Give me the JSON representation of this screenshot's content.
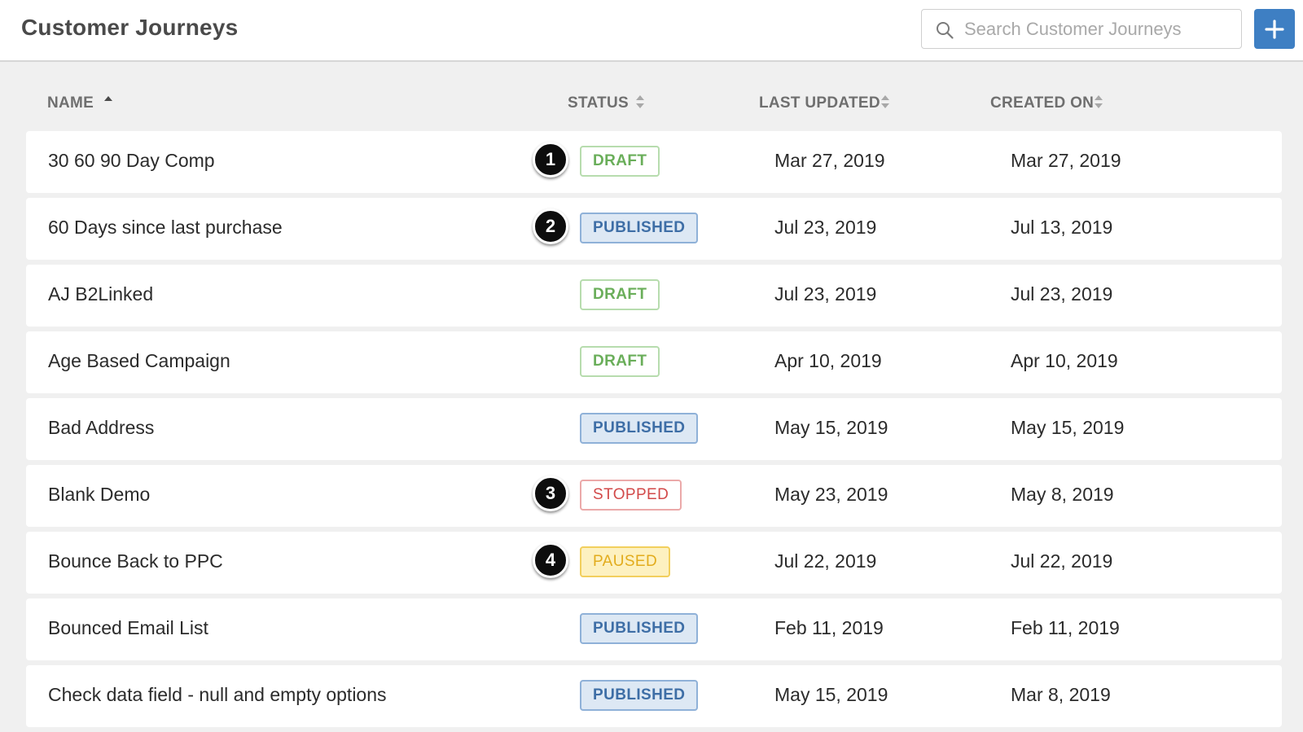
{
  "header": {
    "title": "Customer Journeys",
    "search_placeholder": "Search Customer Journeys",
    "add_icon": "plus-icon",
    "search_icon": "search-icon"
  },
  "columns": {
    "name": "NAME",
    "status": "STATUS",
    "last_updated": "LAST UPDATED",
    "created_on": "CREATED ON",
    "sorted_by": "NAME",
    "sort_direction": "ascending"
  },
  "rows": [
    {
      "name": "30 60 90 Day Comp",
      "status": "DRAFT",
      "status_kind": "draft",
      "last_updated": "Mar 27, 2019",
      "created_on": "Mar 27, 2019",
      "marker": "1"
    },
    {
      "name": "60 Days since last purchase",
      "status": "PUBLISHED",
      "status_kind": "published",
      "last_updated": "Jul 23, 2019",
      "created_on": "Jul 13, 2019",
      "marker": "2"
    },
    {
      "name": "AJ B2Linked",
      "status": "DRAFT",
      "status_kind": "draft",
      "last_updated": "Jul 23, 2019",
      "created_on": "Jul 23, 2019",
      "marker": ""
    },
    {
      "name": "Age Based Campaign",
      "status": "DRAFT",
      "status_kind": "draft",
      "last_updated": "Apr 10, 2019",
      "created_on": "Apr 10, 2019",
      "marker": ""
    },
    {
      "name": "Bad Address",
      "status": "PUBLISHED",
      "status_kind": "published",
      "last_updated": "May 15, 2019",
      "created_on": "May 15, 2019",
      "marker": ""
    },
    {
      "name": "Blank Demo",
      "status": "STOPPED",
      "status_kind": "stopped",
      "last_updated": "May 23, 2019",
      "created_on": "May 8, 2019",
      "marker": "3"
    },
    {
      "name": "Bounce Back to PPC",
      "status": "PAUSED",
      "status_kind": "paused",
      "last_updated": "Jul 22, 2019",
      "created_on": "Jul 22, 2019",
      "marker": "4"
    },
    {
      "name": "Bounced Email List",
      "status": "PUBLISHED",
      "status_kind": "published",
      "last_updated": "Feb 11, 2019",
      "created_on": "Feb 11, 2019",
      "marker": ""
    },
    {
      "name": "Check data field - null and empty options",
      "status": "PUBLISHED",
      "status_kind": "published",
      "last_updated": "May 15, 2019",
      "created_on": "Mar 8, 2019",
      "marker": ""
    }
  ],
  "colors": {
    "accent": "#3e7fc3",
    "draft": "#6aae5a",
    "published": "#3e6ea6",
    "stopped": "#d24a4a",
    "paused": "#e2ac1d"
  }
}
